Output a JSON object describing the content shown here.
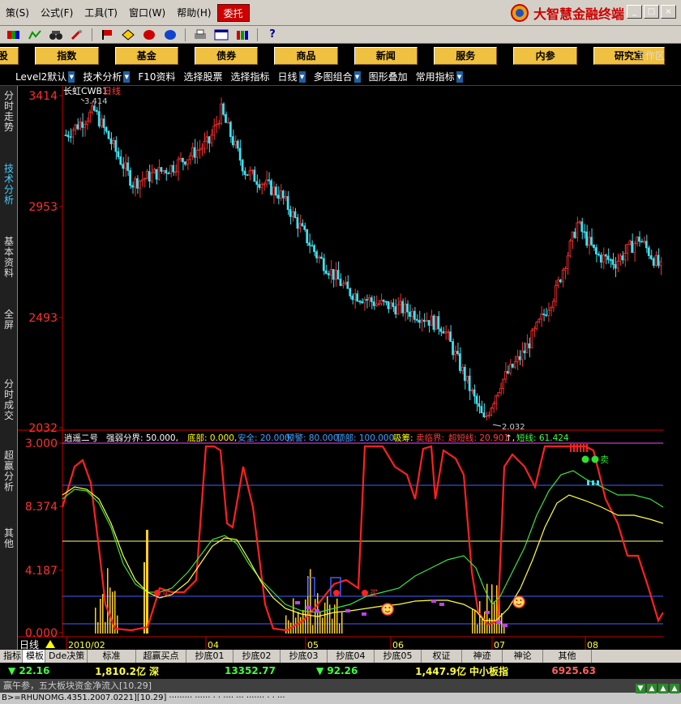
{
  "menu": {
    "items": [
      "策(S)",
      "公式(F)",
      "工具(T)",
      "窗口(W)",
      "帮助(H)",
      "委托"
    ],
    "brand": "大智慧金融终端"
  },
  "window_buttons": [
    "_",
    "□",
    "×"
  ],
  "toolbar_icons": [
    "color-block-icon",
    "chart-icon",
    "binoculars-icon",
    "tools-icon",
    "flag-icon",
    "diamond-icon",
    "red-ball-icon",
    "blue-ball-icon",
    "print-icon",
    "window-icon",
    "books-icon",
    "help-icon"
  ],
  "nav": {
    "buttons": [
      "股",
      "指数",
      "基金",
      "债券",
      "商品",
      "新闻",
      "服务",
      "内参",
      "研究室"
    ],
    "workarea": "工作区"
  },
  "subtoolbar": [
    "Level2默认",
    "技术分析",
    "F10资料",
    "选择股票",
    "选择指标",
    "日线",
    "多图组合",
    "图形叠加",
    "常用指标"
  ],
  "sidebar": [
    "分时走势",
    "技术分析",
    "基本资料",
    "全屏",
    "分时成交",
    "超赢分析",
    "其他"
  ],
  "price_panel": {
    "stock_name": "长虹CWB1",
    "period": "日线",
    "high_label": "3.414",
    "low_label": "2.032",
    "y_labels": [
      "3414",
      "2953",
      "2493",
      "2032"
    ]
  },
  "indicator_panel": {
    "header": [
      {
        "t": "逍遥二号",
        "c": "#ffffff"
      },
      {
        "t": "强弱分界: 50.000,",
        "c": "#ffffff"
      },
      {
        "t": "底部: 0.000,",
        "c": "#ffff00"
      },
      {
        "t": "安全: 20.000,",
        "c": "#40a0ff"
      },
      {
        "t": "预警: 80.000,",
        "c": "#40a0ff"
      },
      {
        "t": "顶部: 100.000,",
        "c": "#40a0ff"
      },
      {
        "t": "吸筹:",
        "c": "#ffff00"
      },
      {
        "t": "卖临界:",
        "c": "#ff4040"
      },
      {
        "t": "超短线: 20.901",
        "c": "#ff4040"
      },
      {
        "t": "↑,",
        "c": "#ffffff"
      },
      {
        "t": "短线: 61.424",
        "c": "#40ff40"
      }
    ],
    "y_labels": [
      "3.000",
      "8.374",
      "4.187",
      "0.000"
    ],
    "sell_label": "卖",
    "buy_labels": [
      "买",
      "买"
    ],
    "right_labels": [
      "净",
      "分",
      "比",
      "分"
    ]
  },
  "x_axis": {
    "period_label": "日线",
    "labels": [
      "2010/02",
      "04",
      "05",
      "06",
      "07",
      "08"
    ]
  },
  "bottom_tabs": [
    "指标",
    "模板",
    "Dde决策",
    "标准",
    "超赢买点",
    "抄底01",
    "抄底02",
    "抄底03",
    "抄底04",
    "抄底05",
    "权证",
    "神迹",
    "神论",
    "其他"
  ],
  "status": {
    "sh_change": "▼ 22.16",
    "sh_amount": "1,810.2亿",
    "sz_label": "深",
    "sz_index": "13352.77",
    "sz_change": "▼ 92.26",
    "sz_amount": "1,447.9亿",
    "smb_label": "中小板指",
    "smb_index": "6925.63"
  },
  "news": "赢午参，五大板块资金净流入[10.29]",
  "ticker": "B>=RHUNOMG.4351.2007.0221][10.29]  ·········   ······  ·  ·  ···· ···  ·······  ·  ·  ···",
  "colors": {
    "up": "#ff3030",
    "down": "#40e0f0",
    "ma_white": "#ffffff",
    "line_red": "#ff2020",
    "line_yellow": "#ffff40",
    "line_green": "#40e040",
    "level_blue": "#4060ff"
  }
}
